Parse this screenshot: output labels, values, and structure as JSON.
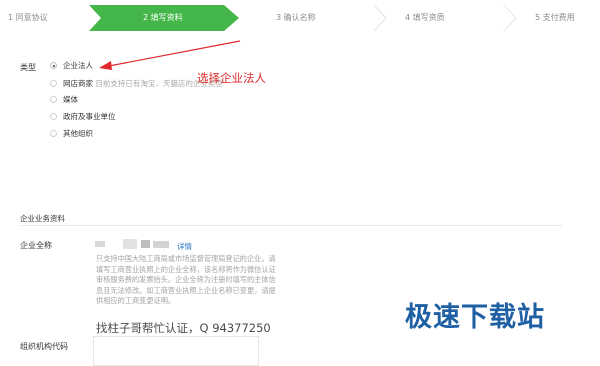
{
  "steps": [
    {
      "label": "1 同意协议",
      "active": false
    },
    {
      "label": "2 填写资料",
      "active": true
    },
    {
      "label": "3 确认名称",
      "active": false
    },
    {
      "label": "4 填写资质",
      "active": false
    },
    {
      "label": "5 支付费用",
      "active": false
    }
  ],
  "colors": {
    "accent": "#45b649",
    "arrow": "#e0282a",
    "link": "#1e6ec9",
    "brand": "#1f5fa3"
  },
  "type_section": {
    "label": "类型",
    "options": [
      {
        "label": "企业法人",
        "hint": "",
        "checked": true
      },
      {
        "label": "网店商家",
        "hint": "目前支持已有淘宝、天猫店的企业类型",
        "checked": false
      },
      {
        "label": "媒体",
        "hint": "",
        "checked": false
      },
      {
        "label": "政府及事业单位",
        "hint": "",
        "checked": false
      },
      {
        "label": "其他组织",
        "hint": "",
        "checked": false
      }
    ]
  },
  "annotation": "选择企业法人",
  "business_section": {
    "title": "企业业务资料",
    "full_name_label": "企业全称",
    "detail_link": "详情",
    "description": "只支持中国大陆工商局或市场监督管理局登记的企业。请填写工商营业执照上的企业全称，该名称将作为微信认证审核服务费的发票抬头。企业全称为注册时填写的主体信息且无法修改。如工商营业执照上企业名称已变更，请提供相应的工商变更证明。",
    "org_code_label": "组织机构代码"
  },
  "watermark_text": "找柱子哥帮忙认证，Q 94377250",
  "brand": "极速下载站"
}
